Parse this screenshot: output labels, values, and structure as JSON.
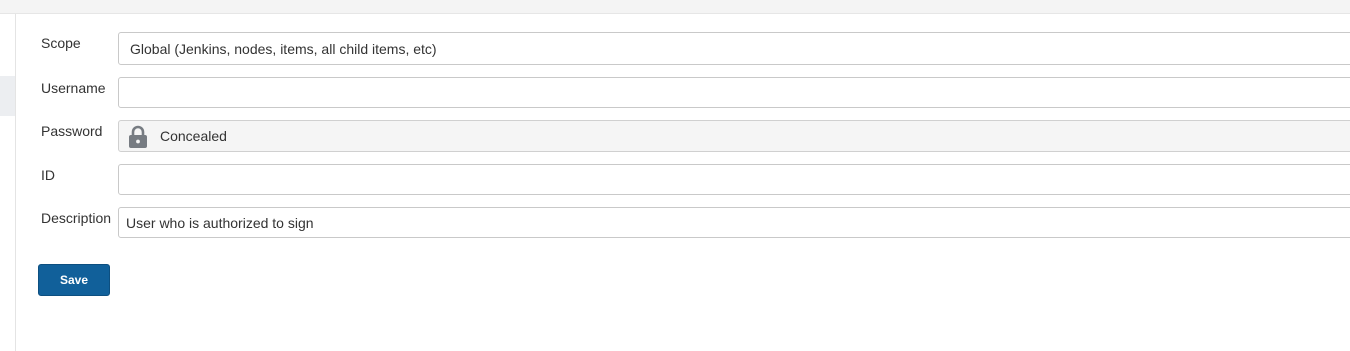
{
  "form": {
    "scope": {
      "label": "Scope",
      "value": "Global (Jenkins, nodes, items, all child items, etc)"
    },
    "username": {
      "label": "Username",
      "value": ""
    },
    "password": {
      "label": "Password",
      "value": "Concealed",
      "icon": "lock-icon"
    },
    "id": {
      "label": "ID",
      "value": ""
    },
    "description": {
      "label": "Description",
      "value": "User who is authorized to sign"
    }
  },
  "actions": {
    "save_label": "Save"
  },
  "colors": {
    "primary_button": "#11609a",
    "concealed_background": "#f5f5f5"
  }
}
